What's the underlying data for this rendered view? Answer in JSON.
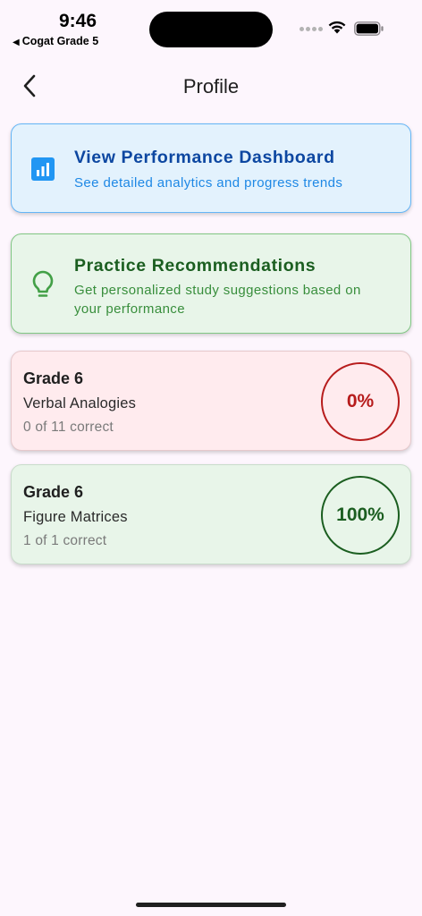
{
  "status_bar": {
    "time": "9:46",
    "back_app": "Cogat Grade 5",
    "back_arrow": "◀"
  },
  "header": {
    "title": "Profile",
    "back_icon": "chevron-left-icon"
  },
  "dashboard_card": {
    "title": "View Performance Dashboard",
    "subtitle": "See detailed analytics and progress trends",
    "icon": "bar-chart-icon",
    "accent": "#2196f3"
  },
  "recommend_card": {
    "title": "Practice Recommendations",
    "subtitle": "Get personalized study suggestions based on your performance",
    "icon": "lightbulb-icon",
    "accent": "#43a047"
  },
  "results": [
    {
      "grade": "Grade 6",
      "topic": "Verbal Analogies",
      "score": "0 of 11 correct",
      "percent": "0%",
      "color": "#b71c1c"
    },
    {
      "grade": "Grade 6",
      "topic": "Figure Matrices",
      "score": "1 of 1 correct",
      "percent": "100%",
      "color": "#1b5e20"
    }
  ]
}
